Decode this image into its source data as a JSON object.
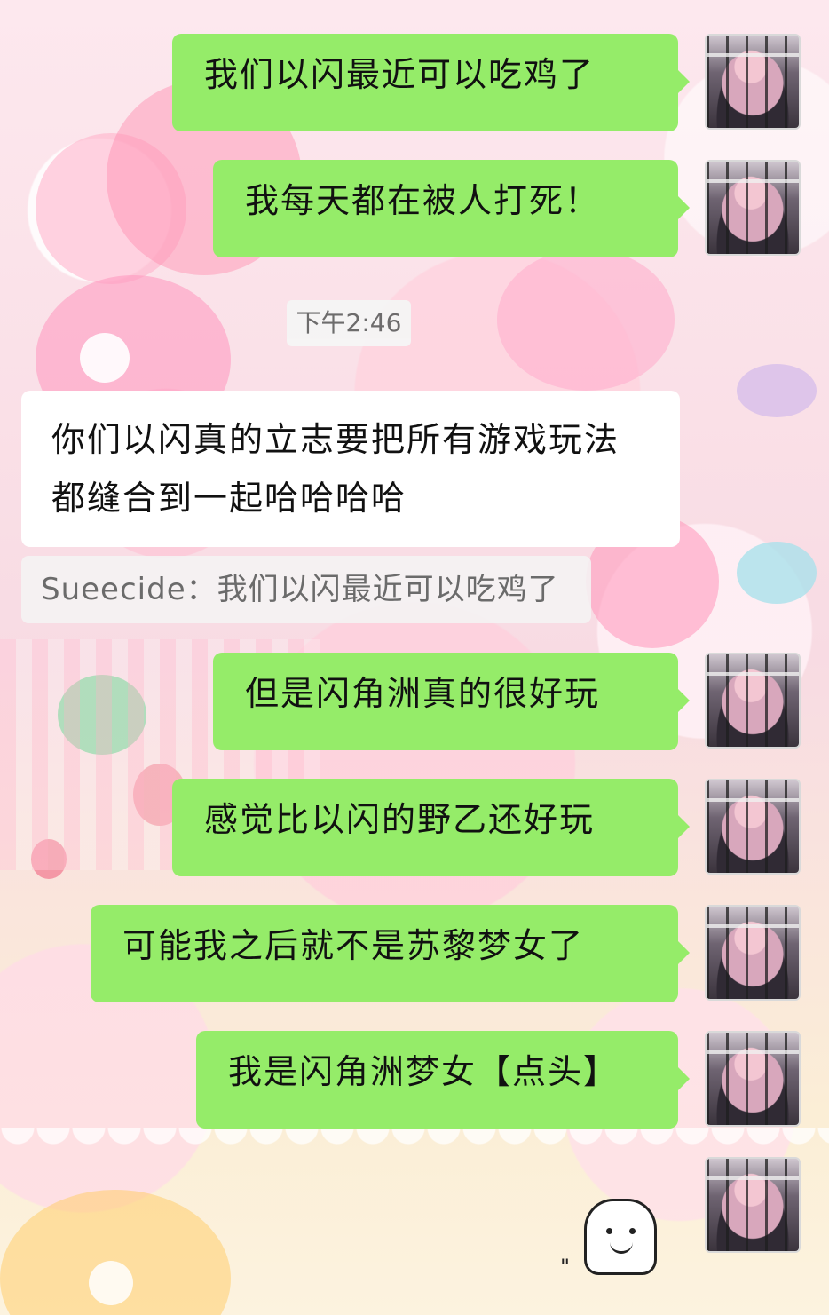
{
  "chat": {
    "timestamp": "下午2:46",
    "messages": [
      {
        "side": "me",
        "text": "我们以闪最近可以吃鸡了"
      },
      {
        "side": "me",
        "text": "我每天都在被人打死！"
      },
      {
        "side": "other",
        "text": "你们以闪真的立志要把所有游戏玩法都缝合到一起哈哈哈哈"
      },
      {
        "side": "me",
        "text": "但是闪角洲真的很好玩"
      },
      {
        "side": "me",
        "text": "感觉比以闪的野乙还好玩"
      },
      {
        "side": "me",
        "text": "可能我之后就不是苏黎梦女了"
      },
      {
        "side": "me",
        "text": "我是闪角洲梦女【点头】"
      }
    ],
    "quote": "Sueecide：我们以闪最近可以吃鸡了",
    "sticker_icon": "ghost-sticker-icon"
  },
  "colors": {
    "sent_bubble": "#95ec69",
    "received_bubble": "#ffffff",
    "timestamp_bg": "#f5f5f5",
    "quote_text": "#6b6b6b"
  }
}
